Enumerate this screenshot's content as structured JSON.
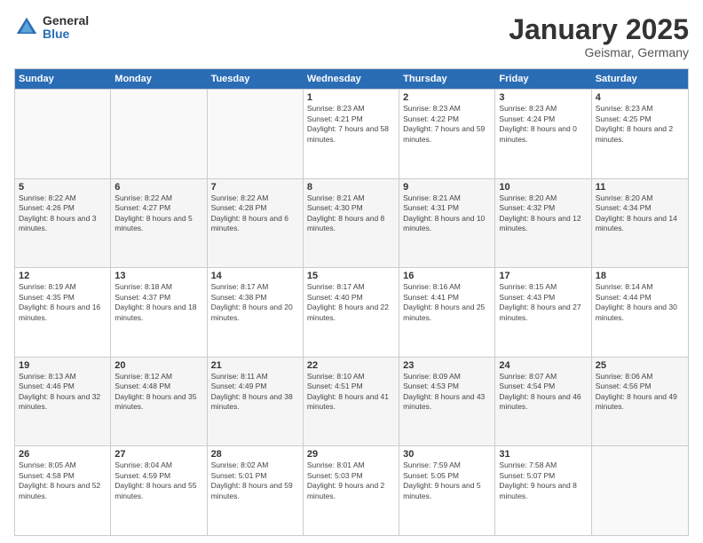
{
  "logo": {
    "general": "General",
    "blue": "Blue"
  },
  "title": "January 2025",
  "location": "Geismar, Germany",
  "days": [
    "Sunday",
    "Monday",
    "Tuesday",
    "Wednesday",
    "Thursday",
    "Friday",
    "Saturday"
  ],
  "weeks": [
    [
      {
        "day": "",
        "empty": true
      },
      {
        "day": "",
        "empty": true
      },
      {
        "day": "",
        "empty": true
      },
      {
        "day": "1",
        "sunrise": "8:23 AM",
        "sunset": "4:21 PM",
        "daylight": "7 hours and 58 minutes."
      },
      {
        "day": "2",
        "sunrise": "8:23 AM",
        "sunset": "4:22 PM",
        "daylight": "7 hours and 59 minutes."
      },
      {
        "day": "3",
        "sunrise": "8:23 AM",
        "sunset": "4:24 PM",
        "daylight": "8 hours and 0 minutes."
      },
      {
        "day": "4",
        "sunrise": "8:23 AM",
        "sunset": "4:25 PM",
        "daylight": "8 hours and 2 minutes."
      }
    ],
    [
      {
        "day": "5",
        "sunrise": "8:22 AM",
        "sunset": "4:26 PM",
        "daylight": "8 hours and 3 minutes."
      },
      {
        "day": "6",
        "sunrise": "8:22 AM",
        "sunset": "4:27 PM",
        "daylight": "8 hours and 5 minutes."
      },
      {
        "day": "7",
        "sunrise": "8:22 AM",
        "sunset": "4:28 PM",
        "daylight": "8 hours and 6 minutes."
      },
      {
        "day": "8",
        "sunrise": "8:21 AM",
        "sunset": "4:30 PM",
        "daylight": "8 hours and 8 minutes."
      },
      {
        "day": "9",
        "sunrise": "8:21 AM",
        "sunset": "4:31 PM",
        "daylight": "8 hours and 10 minutes."
      },
      {
        "day": "10",
        "sunrise": "8:20 AM",
        "sunset": "4:32 PM",
        "daylight": "8 hours and 12 minutes."
      },
      {
        "day": "11",
        "sunrise": "8:20 AM",
        "sunset": "4:34 PM",
        "daylight": "8 hours and 14 minutes."
      }
    ],
    [
      {
        "day": "12",
        "sunrise": "8:19 AM",
        "sunset": "4:35 PM",
        "daylight": "8 hours and 16 minutes."
      },
      {
        "day": "13",
        "sunrise": "8:18 AM",
        "sunset": "4:37 PM",
        "daylight": "8 hours and 18 minutes."
      },
      {
        "day": "14",
        "sunrise": "8:17 AM",
        "sunset": "4:38 PM",
        "daylight": "8 hours and 20 minutes."
      },
      {
        "day": "15",
        "sunrise": "8:17 AM",
        "sunset": "4:40 PM",
        "daylight": "8 hours and 22 minutes."
      },
      {
        "day": "16",
        "sunrise": "8:16 AM",
        "sunset": "4:41 PM",
        "daylight": "8 hours and 25 minutes."
      },
      {
        "day": "17",
        "sunrise": "8:15 AM",
        "sunset": "4:43 PM",
        "daylight": "8 hours and 27 minutes."
      },
      {
        "day": "18",
        "sunrise": "8:14 AM",
        "sunset": "4:44 PM",
        "daylight": "8 hours and 30 minutes."
      }
    ],
    [
      {
        "day": "19",
        "sunrise": "8:13 AM",
        "sunset": "4:46 PM",
        "daylight": "8 hours and 32 minutes."
      },
      {
        "day": "20",
        "sunrise": "8:12 AM",
        "sunset": "4:48 PM",
        "daylight": "8 hours and 35 minutes."
      },
      {
        "day": "21",
        "sunrise": "8:11 AM",
        "sunset": "4:49 PM",
        "daylight": "8 hours and 38 minutes."
      },
      {
        "day": "22",
        "sunrise": "8:10 AM",
        "sunset": "4:51 PM",
        "daylight": "8 hours and 41 minutes."
      },
      {
        "day": "23",
        "sunrise": "8:09 AM",
        "sunset": "4:53 PM",
        "daylight": "8 hours and 43 minutes."
      },
      {
        "day": "24",
        "sunrise": "8:07 AM",
        "sunset": "4:54 PM",
        "daylight": "8 hours and 46 minutes."
      },
      {
        "day": "25",
        "sunrise": "8:06 AM",
        "sunset": "4:56 PM",
        "daylight": "8 hours and 49 minutes."
      }
    ],
    [
      {
        "day": "26",
        "sunrise": "8:05 AM",
        "sunset": "4:58 PM",
        "daylight": "8 hours and 52 minutes."
      },
      {
        "day": "27",
        "sunrise": "8:04 AM",
        "sunset": "4:59 PM",
        "daylight": "8 hours and 55 minutes."
      },
      {
        "day": "28",
        "sunrise": "8:02 AM",
        "sunset": "5:01 PM",
        "daylight": "8 hours and 59 minutes."
      },
      {
        "day": "29",
        "sunrise": "8:01 AM",
        "sunset": "5:03 PM",
        "daylight": "9 hours and 2 minutes."
      },
      {
        "day": "30",
        "sunrise": "7:59 AM",
        "sunset": "5:05 PM",
        "daylight": "9 hours and 5 minutes."
      },
      {
        "day": "31",
        "sunrise": "7:58 AM",
        "sunset": "5:07 PM",
        "daylight": "9 hours and 8 minutes."
      },
      {
        "day": "",
        "empty": true
      }
    ]
  ]
}
